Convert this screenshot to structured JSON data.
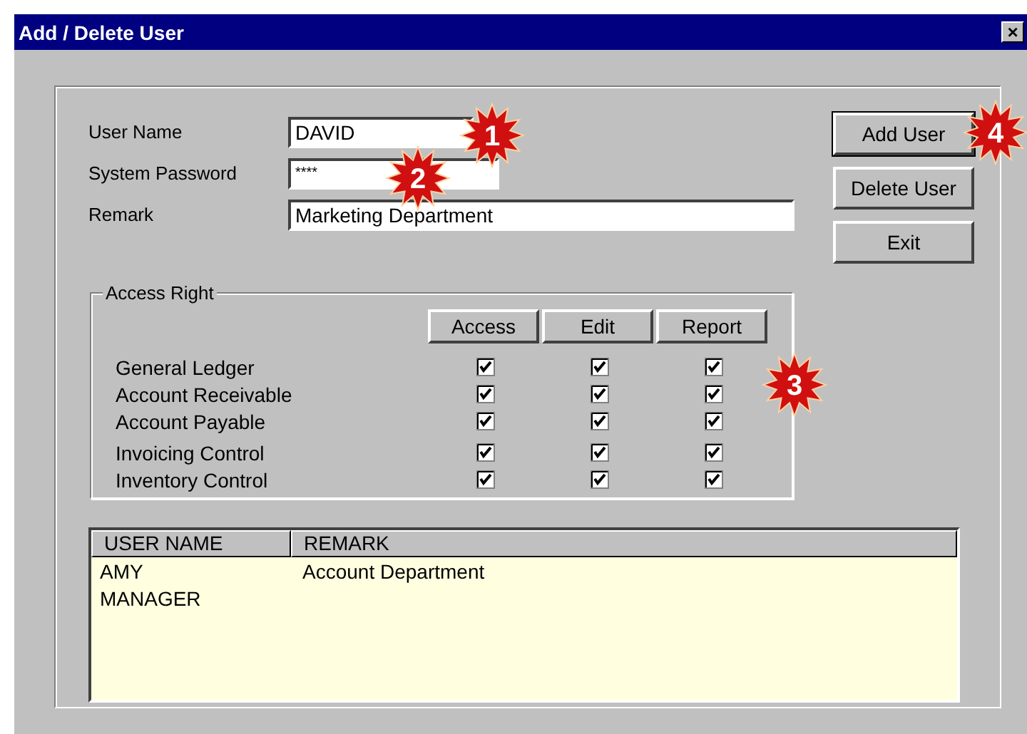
{
  "window": {
    "title": "Add / Delete User",
    "close": "×"
  },
  "fields": [
    {
      "label": "User Name",
      "value": "DAVID",
      "kind": "short"
    },
    {
      "label": "System Password",
      "value": "****",
      "kind": "password"
    },
    {
      "label": "Remark",
      "value": "Marketing Department",
      "kind": "long"
    }
  ],
  "buttons": [
    {
      "label": "Add User",
      "default": true
    },
    {
      "label": "Delete User",
      "default": false
    },
    {
      "label": "Exit",
      "default": false
    }
  ],
  "access_right": {
    "title": "Access Right",
    "columns": [
      "Access",
      "Edit",
      "Report"
    ],
    "rows": [
      {
        "label": "General Ledger",
        "checks": [
          {
            "checked": true
          },
          {
            "checked": true
          },
          {
            "checked": true
          }
        ]
      },
      {
        "label": "Account Receivable",
        "checks": [
          {
            "checked": true
          },
          {
            "checked": true
          },
          {
            "checked": true
          }
        ]
      },
      {
        "label": "Account Payable",
        "checks": [
          {
            "checked": true
          },
          {
            "checked": true
          },
          {
            "checked": true
          }
        ]
      },
      {
        "label": "Invoicing Control",
        "checks": [
          {
            "checked": true
          },
          {
            "checked": true
          },
          {
            "checked": true
          }
        ]
      },
      {
        "label": "Inventory Control",
        "checks": [
          {
            "checked": true
          },
          {
            "checked": true
          },
          {
            "checked": true
          }
        ]
      }
    ]
  },
  "user_list": {
    "columns": [
      "USER NAME",
      "REMARK"
    ],
    "rows": [
      [
        "AMY",
        "Account Department"
      ],
      [
        "MANAGER",
        ""
      ]
    ]
  },
  "callouts": [
    {
      "label": "1"
    },
    {
      "label": "2"
    },
    {
      "label": "3"
    },
    {
      "label": "4"
    }
  ]
}
